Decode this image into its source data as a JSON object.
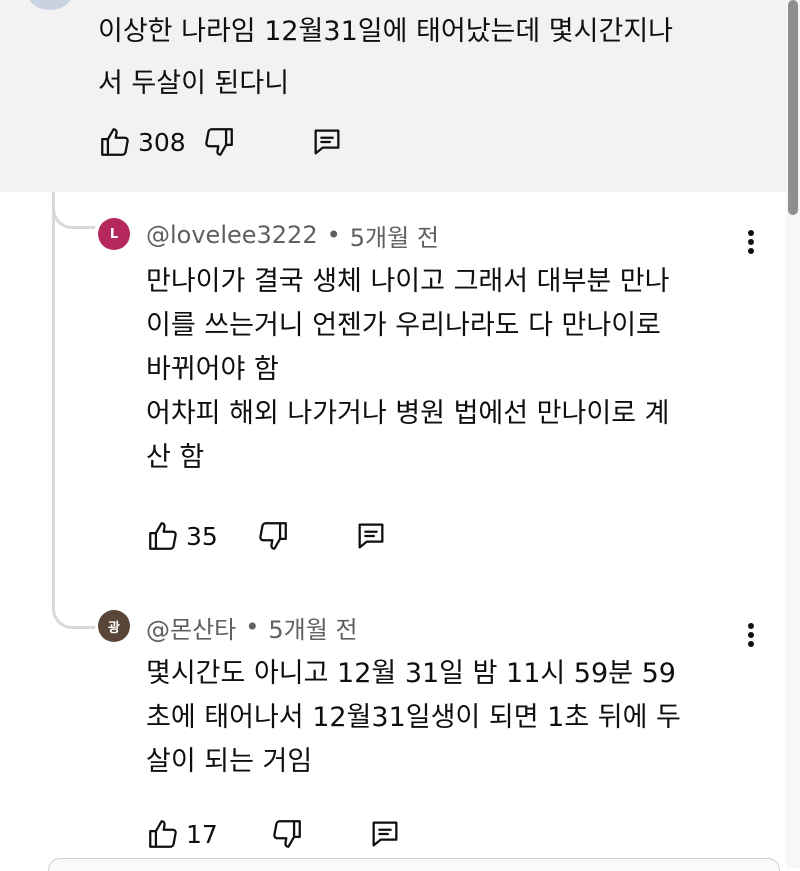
{
  "parent_comment": {
    "text_lines": [
      "이상한 나라임 12월31일에 태어났는데 몇시간지나",
      "서 두살이 된다니"
    ],
    "likes": "308"
  },
  "replies": [
    {
      "avatar_letter": "L",
      "avatar_color": "#b5285c",
      "author": "@lovelee3222",
      "separator": "•",
      "time": "5개월 전",
      "text_lines": [
        "만나이가 결국 생체 나이고 그래서 대부분 만나",
        "이를 쓰는거니 언젠가 우리나라도 다 만나이로",
        "바뀌어야 함",
        "어차피 해외 나가거나 병원 법에선 만나이로 계",
        "산 함"
      ],
      "likes": "35"
    },
    {
      "avatar_letter": "광",
      "avatar_color": "#5a4638",
      "author": "@몬산타",
      "separator": "•",
      "time": "5개월 전",
      "text_lines": [
        "몇시간도 아니고 12월 31일 밤 11시 59분 59",
        "초에 태어나서 12월31일생이 되면 1초 뒤에 두",
        "살이 되는 거임"
      ],
      "likes": "17"
    }
  ],
  "icons": {
    "like": "thumbs-up-icon",
    "dislike": "thumbs-down-icon",
    "reply": "reply-comment-icon",
    "more": "more-vertical-icon"
  }
}
